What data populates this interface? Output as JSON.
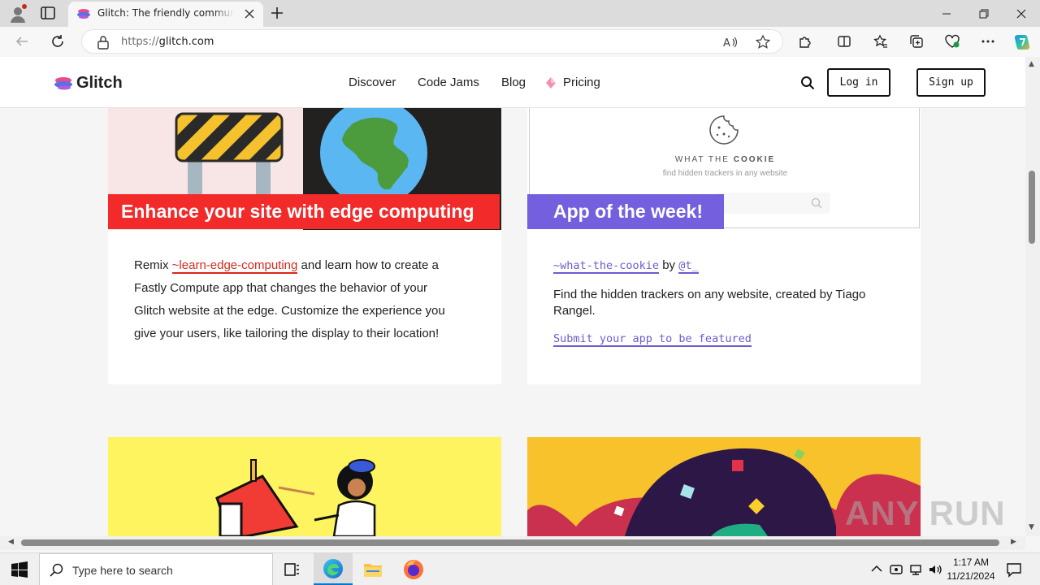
{
  "browser": {
    "tab_title": "Glitch: The friendly community where everyone builds the web",
    "url_protocol": "https://",
    "url_host": "glitch.com"
  },
  "site": {
    "logo_text": "Glitch",
    "nav": {
      "discover": "Discover",
      "code_jams": "Code Jams",
      "blog": "Blog",
      "pricing": "Pricing"
    },
    "login_label": "Log in",
    "signup_label": "Sign up"
  },
  "cards": {
    "edge": {
      "badge": "Enhance your site with edge computing",
      "text_prefix": "Remix ",
      "link": "~learn-edge-computing",
      "text_line1_rest": " and learn how to create a",
      "text_line2": "Fastly Compute app that changes the behavior of your",
      "text_line3": "Glitch website at the edge. Customize the experience you",
      "text_line4": "give your users, like tailoring the display to their location!"
    },
    "app_of_week": {
      "badge": "App of the week!",
      "art_title_plain": "WHAT THE ",
      "art_title_bold": "COOKIE",
      "art_subtitle": "find hidden trackers in any website",
      "project_link": "~what-the-cookie",
      "by": " by ",
      "author": "@t_",
      "description_line1": "Find the hidden trackers on any website, created by Tiago",
      "description_line2": "Rangel.",
      "submit_link": "Submit your app to be featured"
    }
  },
  "watermark": "ANY RUN",
  "taskbar": {
    "search_placeholder": "Type here to search",
    "time": "1:17 AM",
    "date": "11/21/2024"
  },
  "colors": {
    "edge_red": "#f32a2a",
    "purple": "#7460de",
    "yellow_art": "#fdf45f",
    "accent_blue": "#0078d4"
  }
}
